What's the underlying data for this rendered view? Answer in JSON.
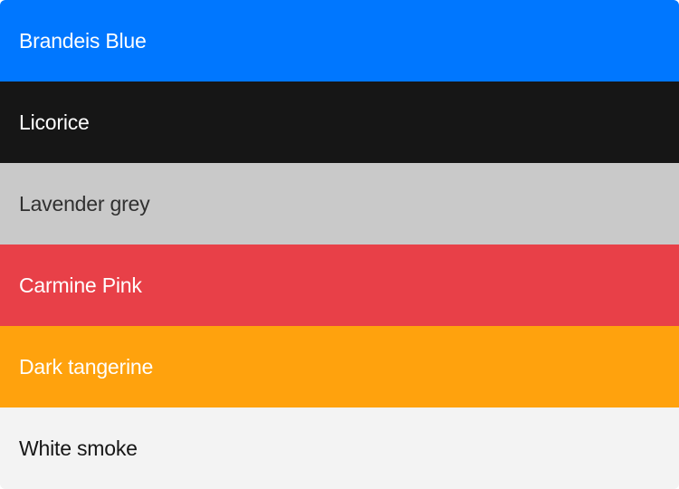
{
  "swatches": [
    {
      "name": "Brandeis Blue",
      "color": "#0077FF",
      "text_color": "#FFFFFF"
    },
    {
      "name": "Licorice",
      "color": "#161616",
      "text_color": "#FFFFFF"
    },
    {
      "name": "Lavender grey",
      "color": "#C9C9C9",
      "text_color": "#303030"
    },
    {
      "name": "Carmine Pink",
      "color": "#E84048",
      "text_color": "#FFFFFF"
    },
    {
      "name": "Dark tangerine",
      "color": "#FFA20D",
      "text_color": "#FFFFFF"
    },
    {
      "name": "White smoke",
      "color": "#F3F3F3",
      "text_color": "#161616"
    }
  ]
}
